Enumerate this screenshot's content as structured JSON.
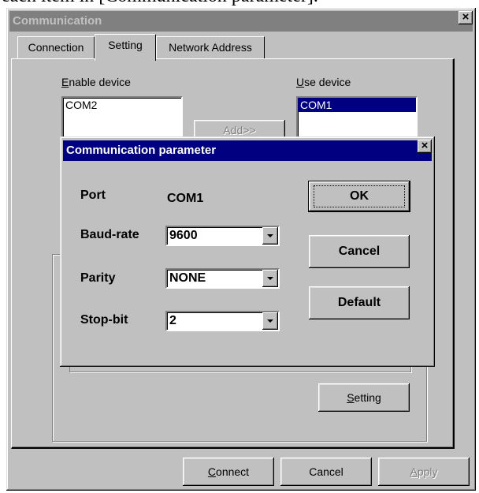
{
  "doc_text": "each item in [Communication parameter].",
  "window": {
    "title": "Communication",
    "close_glyph": "×"
  },
  "tabs": [
    {
      "label": "Connection",
      "selected": false
    },
    {
      "label": "Setting",
      "selected": true
    },
    {
      "label": "Network Address",
      "selected": false
    }
  ],
  "setting": {
    "enable_device_label": "Enable device",
    "enable_device_mnemonic": "E",
    "enable_device_rest": "nable device",
    "use_device_label": "Use device",
    "use_device_mnemonic": "U",
    "use_device_rest": "se device",
    "enable_device_items": [
      "COM2"
    ],
    "use_device_items": [
      "COM1"
    ],
    "add_button": "Add>>",
    "setting_button_mnemonic": "S",
    "setting_button_rest": "etting"
  },
  "footer": {
    "connect_mnemonic": "C",
    "connect_rest": "onnect",
    "cancel": "Cancel",
    "apply_mnemonic": "A",
    "apply_rest": "pply"
  },
  "dialog": {
    "title": "Communication parameter",
    "close_glyph": "×",
    "port_label": "Port",
    "port_value": "COM1",
    "baud_label": "Baud-rate",
    "baud_value": "9600",
    "parity_label": "Parity",
    "parity_value": "NONE",
    "stopbit_label": "Stop-bit",
    "stopbit_value": "2",
    "ok": "OK",
    "cancel": "Cancel",
    "default": "Default"
  },
  "colors": {
    "face": "#c0c0c0",
    "active_title": "#000080",
    "inactive_title": "#808080",
    "selection": "#000080"
  }
}
